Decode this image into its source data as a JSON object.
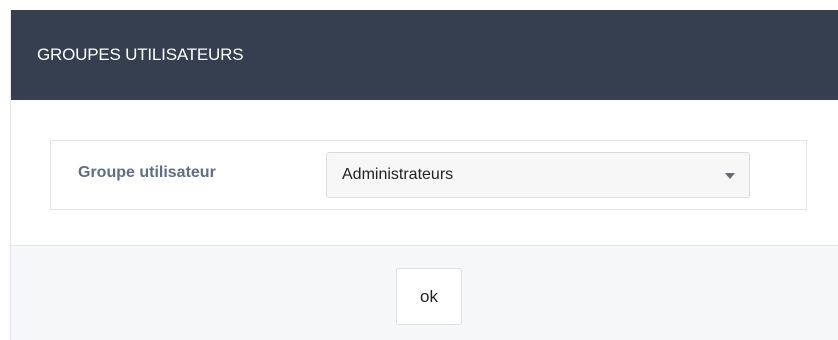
{
  "dialog": {
    "title": "GROUPES UTILISATEURS"
  },
  "form": {
    "group_label": "Groupe utilisateur",
    "group_select": {
      "selected": "Administrateurs",
      "icon": "chevron-down-icon"
    }
  },
  "footer": {
    "ok_label": "ok"
  },
  "colors": {
    "header_bg": "#353f4f",
    "header_text": "#ffffff",
    "label_text": "#5e6f85",
    "footer_bg": "#f6f7f9"
  }
}
